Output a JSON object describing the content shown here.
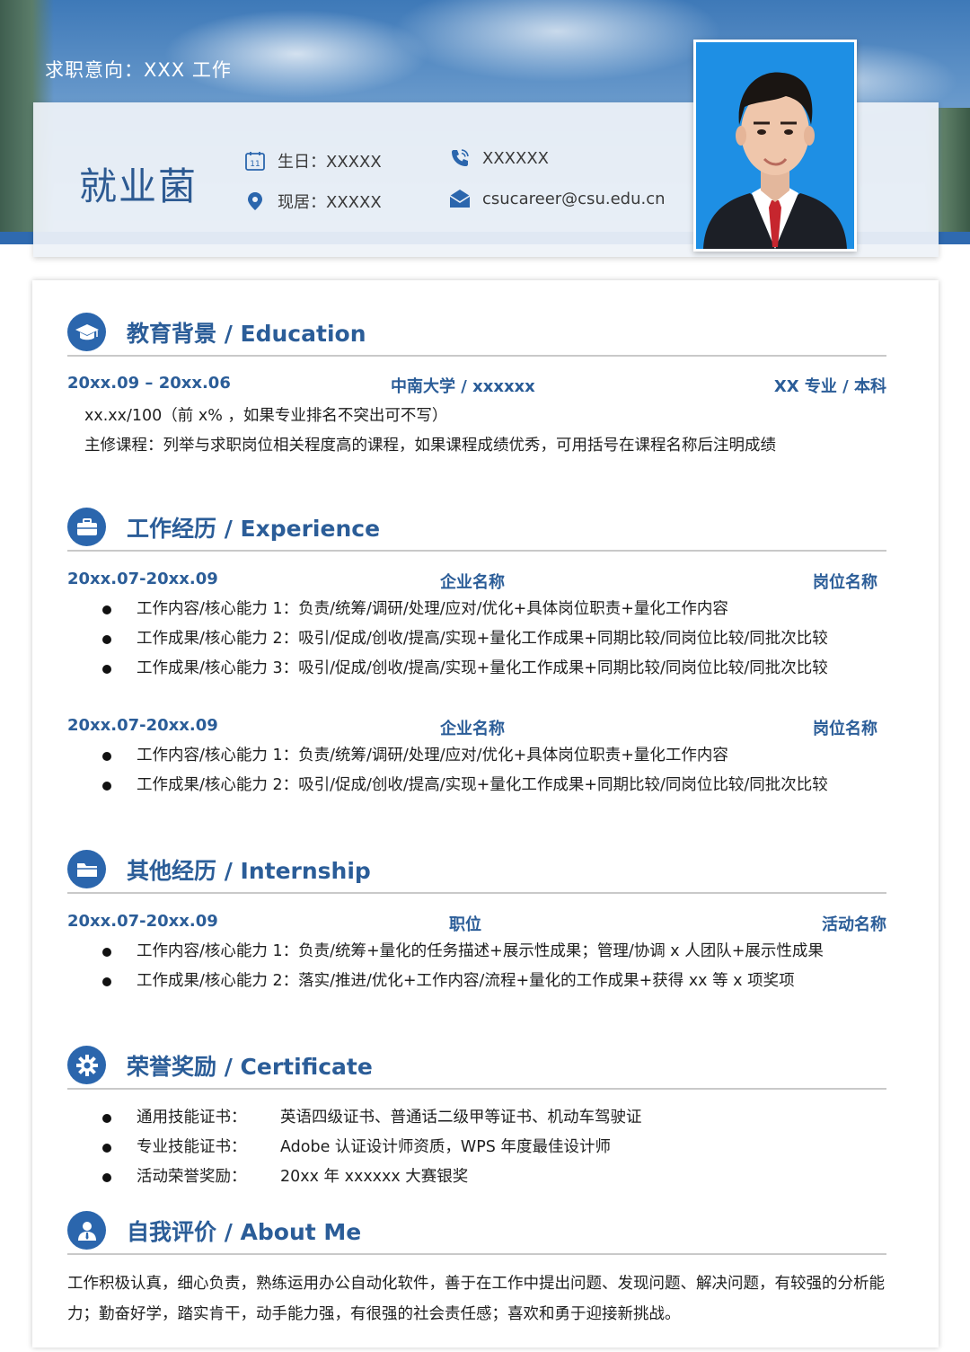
{
  "header": {
    "job_intent": "求职意向：XXX 工作",
    "name": "就业菌",
    "birthday": "生日：XXXXX",
    "residence": "现居：XXXXX",
    "phone": "XXXXXX",
    "email": "csucareer@csu.edu.cn",
    "accent_color": "#2b66ad"
  },
  "education": {
    "title": "教育背景 / Education",
    "period": "20xx.09 – 20xx.06",
    "school": "中南大学 / xxxxxx",
    "major": "XX 专业 / 本科",
    "lines": [
      "xx.xx/100（前 x% ，如果专业排名不突出可不写）",
      "主修课程：列举与求职岗位相关程度高的课程，如果课程成绩优秀，可用括号在课程名称后注明成绩"
    ]
  },
  "experience": {
    "title": "工作经历 / Experience",
    "jobs": [
      {
        "period": "20xx.07-20xx.09",
        "company": "企业名称",
        "position": "岗位名称",
        "items": [
          "工作内容/核心能力 1：负责/统筹/调研/处理/应对/优化+具体岗位职责+量化工作内容",
          "工作成果/核心能力 2：吸引/促成/创收/提高/实现+量化工作成果+同期比较/同岗位比较/同批次比较",
          "工作成果/核心能力 3：吸引/促成/创收/提高/实现+量化工作成果+同期比较/同岗位比较/同批次比较"
        ]
      },
      {
        "period": "20xx.07-20xx.09",
        "company": "企业名称",
        "position": "岗位名称",
        "items": [
          "工作内容/核心能力 1：负责/统筹/调研/处理/应对/优化+具体岗位职责+量化工作内容",
          "工作成果/核心能力 2：吸引/促成/创收/提高/实现+量化工作成果+同期比较/同岗位比较/同批次比较"
        ]
      }
    ]
  },
  "internship": {
    "title": "其他经历 / Internship",
    "period": "20xx.07-20xx.09",
    "role": "职位",
    "activity": "活动名称",
    "items": [
      "工作内容/核心能力 1：负责/统筹+量化的任务描述+展示性成果；管理/协调 x 人团队+展示性成果",
      "工作成果/核心能力 2：落实/推进/优化+工作内容/流程+量化的工作成果+获得 xx 等 x 项奖项"
    ]
  },
  "certificate": {
    "title": "荣誉奖励 / Certificate",
    "items": [
      {
        "label": "通用技能证书：",
        "value": "英语四级证书、普通话二级甲等证书、机动车驾驶证"
      },
      {
        "label": "专业技能证书：",
        "value": "Adobe 认证设计师资质，WPS 年度最佳设计师"
      },
      {
        "label": "活动荣誉奖励：",
        "value": "20xx 年 xxxxxx 大赛银奖"
      }
    ]
  },
  "about": {
    "title": "自我评价 / About Me",
    "text": "工作积极认真，细心负责，熟练运用办公自动化软件，善于在工作中提出问题、发现问题、解决问题，有较强的分析能力；勤奋好学，踏实肯干，动手能力强，有很强的社会责任感；喜欢和勇于迎接新挑战。"
  }
}
